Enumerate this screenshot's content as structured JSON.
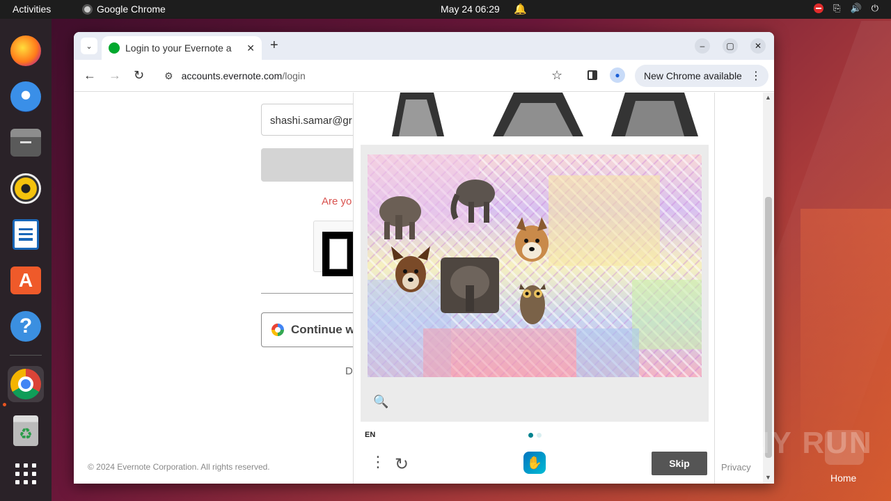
{
  "topbar": {
    "activities": "Activities",
    "app_name": "Google Chrome",
    "clock": "May 24  06:29"
  },
  "dock": {
    "items": [
      "firefox-icon",
      "thunderbird-icon",
      "files-icon",
      "rhythmbox-icon",
      "libreoffice-writer-icon",
      "app-center-icon",
      "help-icon",
      "chrome-icon",
      "trash-icon",
      "show-apps-icon"
    ]
  },
  "browser": {
    "tab_title": "Login to your Evernote a",
    "url_host": "accounts.evernote.com",
    "url_path": "/login",
    "update_label": "New Chrome available"
  },
  "page": {
    "email_value": "shashi.samar@gr",
    "are_you_text": "Are yo",
    "google_button": "Continue wi",
    "d_text": "D",
    "copyright": "© 2024 Evernote Corporation. All rights reserved.",
    "privacy": "Privacy"
  },
  "captcha": {
    "language": "EN",
    "skip_label": "Skip",
    "animals": [
      "elephant",
      "elephant",
      "dog",
      "dog",
      "elephant",
      "owl"
    ]
  },
  "desktop": {
    "home_label": "Home",
    "watermark": "ANY RUN"
  },
  "colors": {
    "accent_orange": "#e95420",
    "evernote_green": "#00a82d",
    "hcaptcha_teal": "#00838f"
  }
}
